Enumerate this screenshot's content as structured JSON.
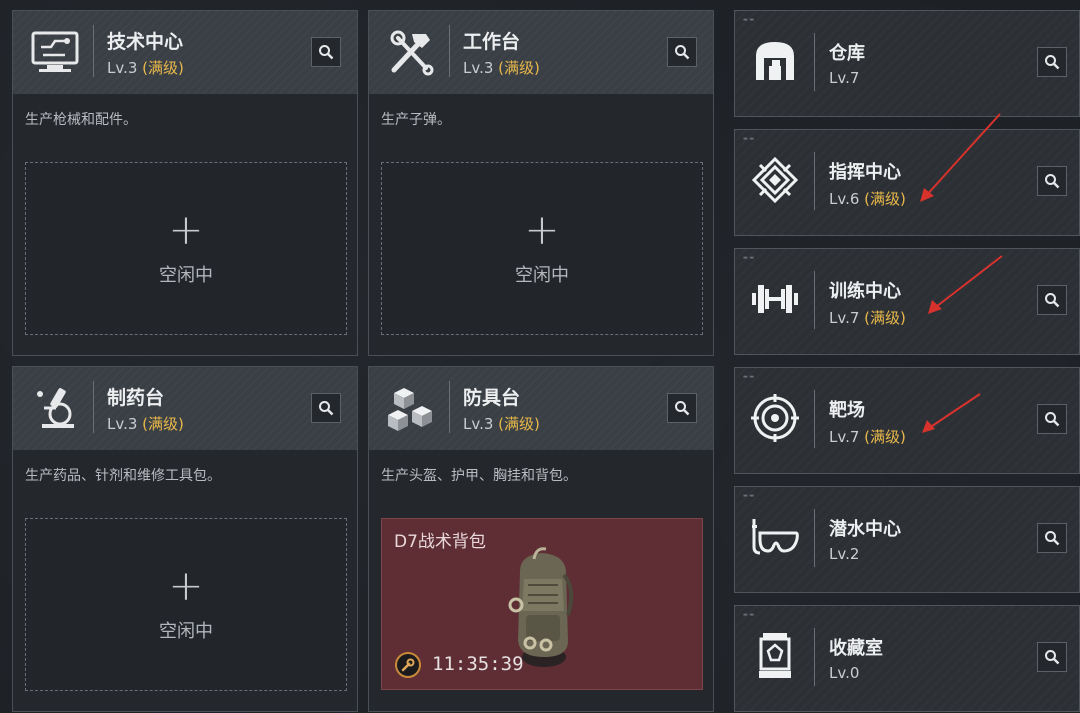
{
  "facilities": [
    {
      "title": "技术中心",
      "level_prefix": "Lv.3",
      "level_suffix": "(满级)",
      "description": "生产枪械和配件。",
      "slot": {
        "plus": "+",
        "status": "空闲中"
      },
      "icon": "computer-icon"
    },
    {
      "title": "工作台",
      "level_prefix": "Lv.3",
      "level_suffix": "(满级)",
      "description": "生产子弹。",
      "slot": {
        "plus": "+",
        "status": "空闲中"
      },
      "icon": "hammer-wrench-icon"
    },
    {
      "title": "制药台",
      "level_prefix": "Lv.3",
      "level_suffix": "(满级)",
      "description": "生产药品、针剂和维修工具包。",
      "slot": {
        "plus": "+",
        "status": "空闲中"
      },
      "icon": "microscope-icon"
    },
    {
      "title": "防具台",
      "level_prefix": "Lv.3",
      "level_suffix": "(满级)",
      "description": "生产头盔、护甲、胸挂和背包。",
      "crafting": {
        "item": "D7战术背包",
        "timer": "11:35:39"
      },
      "icon": "cubes-icon"
    }
  ],
  "side_rooms": [
    {
      "title": "仓库",
      "level_prefix": "Lv.7",
      "level_suffix": "",
      "icon": "warehouse-icon"
    },
    {
      "title": "指挥中心",
      "level_prefix": "Lv.6",
      "level_suffix": "(满级)",
      "icon": "command-emblem-icon"
    },
    {
      "title": "训练中心",
      "level_prefix": "Lv.7",
      "level_suffix": "(满级)",
      "icon": "dumbbell-icon"
    },
    {
      "title": "靶场",
      "level_prefix": "Lv.7",
      "level_suffix": "(满级)",
      "icon": "target-icon"
    },
    {
      "title": "潜水中心",
      "level_prefix": "Lv.2",
      "level_suffix": "",
      "icon": "diving-mask-icon"
    },
    {
      "title": "收藏室",
      "level_prefix": "Lv.0",
      "level_suffix": "",
      "icon": "display-case-icon"
    }
  ],
  "colors": {
    "background": "#1d2126",
    "maxed_level": "#e8b84a",
    "crafting_panel": "#5e2e34",
    "annotation_arrow": "#d8322d"
  }
}
